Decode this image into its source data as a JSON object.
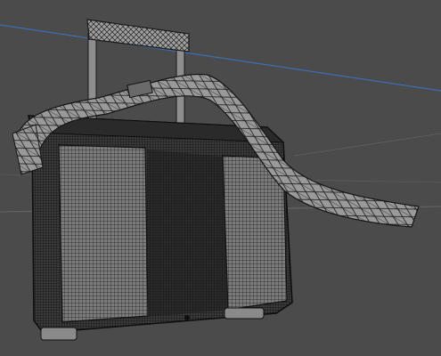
{
  "viewport": {
    "view_mode": "wireframe",
    "background_color": "#4b4b4b",
    "wire_color": "#1a1a1a",
    "mesh_fill_light": "#8f8f8f",
    "mesh_fill_mid": "#6d6d6d",
    "mesh_fill_dark": "#2a2a2a",
    "axis_line_color": "#3b6fb0",
    "grid_line_color": "#7a7a7a"
  },
  "model": {
    "object": "rolling-suitcase-with-strap",
    "parts": [
      "telescopic-handle",
      "suitcase-body",
      "front-pocket-left",
      "front-pocket-right",
      "shoulder-strap",
      "strap-buckle",
      "wheels"
    ]
  }
}
